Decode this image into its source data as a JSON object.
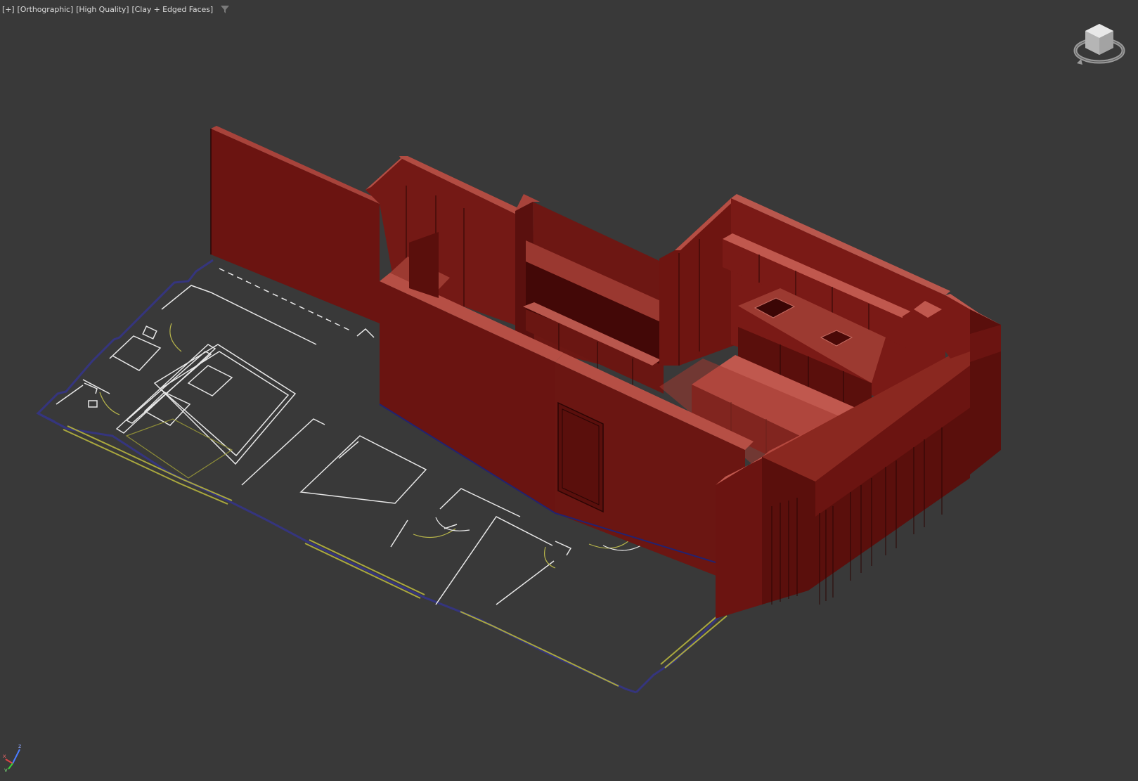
{
  "viewport": {
    "labels": [
      "[+]",
      "[Orthographic]",
      "[High Quality]",
      "[Clay + Edged Faces]"
    ],
    "filter_icon": "filter-icon",
    "background": "#393939"
  },
  "scene": {
    "model": "apartment-floor-plan",
    "wall_color": "#6b1411",
    "wall_light": "#a8433b",
    "wall_top": "#c0584e",
    "plan_line_color": "#e6e6e6",
    "wall_outline_color": "#2f2f7a",
    "glazing_color": "#b8b84a"
  },
  "viewcube": {
    "icon": "viewcube-navigation"
  },
  "axis": {
    "x": "x",
    "y": "y",
    "z": "z"
  }
}
